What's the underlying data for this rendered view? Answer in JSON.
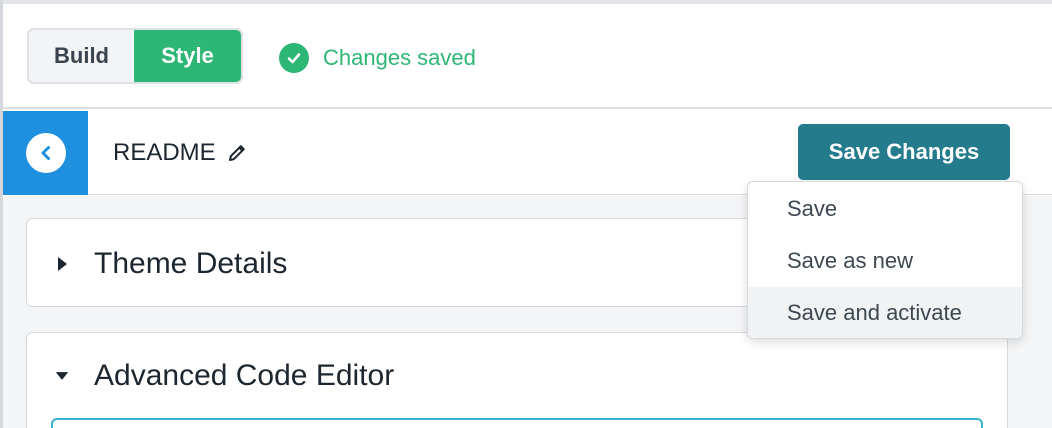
{
  "header": {
    "toggle": {
      "build_label": "Build",
      "style_label": "Style",
      "active": "Style"
    },
    "status": {
      "text": "Changes saved",
      "icon": "check-circle-icon"
    }
  },
  "subbar": {
    "back_icon": "chevron-left-icon",
    "title": "README",
    "edit_icon": "pencil-icon",
    "save_button_label": "Save Changes"
  },
  "save_menu": {
    "items": [
      {
        "label": "Save"
      },
      {
        "label": "Save as new"
      },
      {
        "label": "Save and activate",
        "hovered": true
      }
    ]
  },
  "sections": [
    {
      "title": "Theme Details",
      "expanded": false,
      "icon": "caret-right-icon"
    },
    {
      "title": "Advanced Code Editor",
      "expanded": true,
      "icon": "caret-down-icon"
    }
  ],
  "colors": {
    "accent_green": "#2eb674",
    "back_blue": "#1f8fe0",
    "save_teal": "#237b8c",
    "editor_border": "#37b3c8"
  }
}
